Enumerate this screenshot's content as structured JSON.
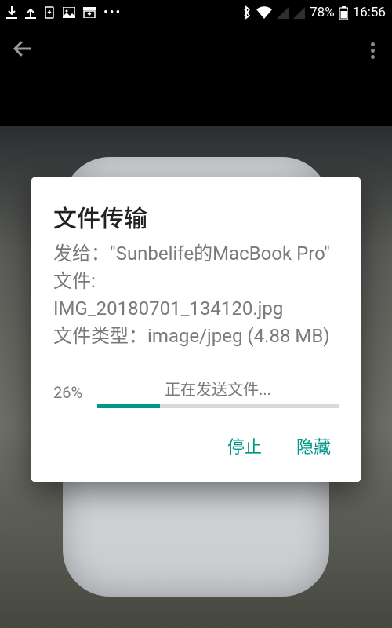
{
  "status": {
    "battery_text": "78%",
    "clock": "16:56"
  },
  "dialog": {
    "title": "文件传输",
    "recipient_label": "发给：",
    "recipient_value": "\"Sunbelife的MacBook Pro\"",
    "file_label": "文件:",
    "file_name": "IMG_20180701_134120.jpg",
    "type_label": "文件类型：",
    "mime": "image/jpeg",
    "size_text": "(4.88 MB)",
    "progress_label": "正在发送文件...",
    "progress_percent": 26,
    "progress_percent_text": "26%",
    "stop_label": "停止",
    "hide_label": "隐藏"
  },
  "colors": {
    "accent": "#009688"
  }
}
